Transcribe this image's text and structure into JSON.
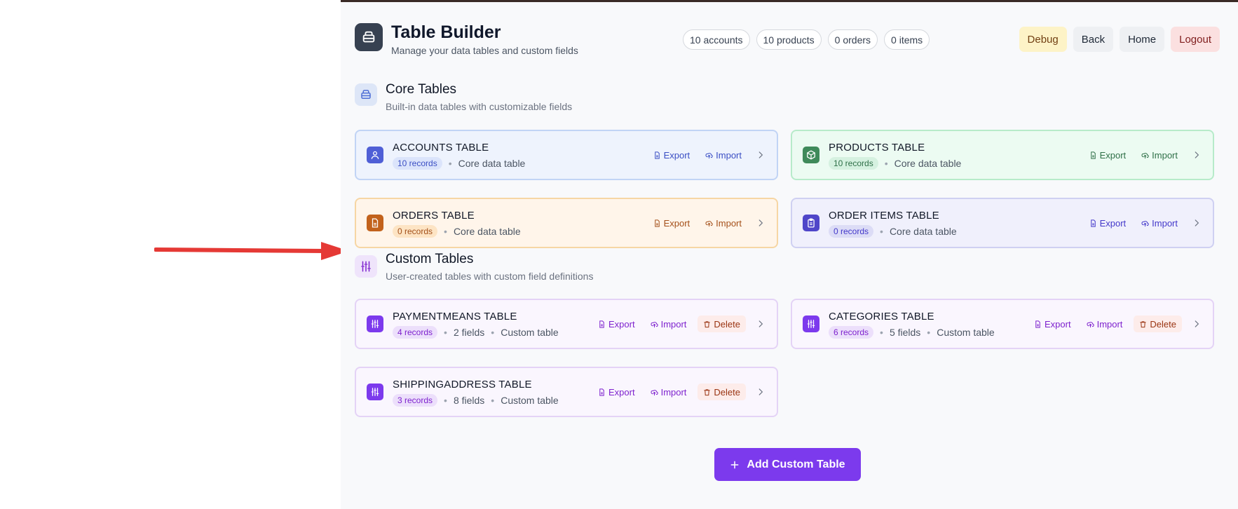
{
  "header": {
    "title": "Table Builder",
    "subtitle": "Manage your data tables and custom fields",
    "stats": [
      "10 accounts",
      "10 products",
      "0 orders",
      "0 items"
    ],
    "buttons": {
      "debug": "Debug",
      "back": "Back",
      "home": "Home",
      "logout": "Logout"
    }
  },
  "core": {
    "title": "Core Tables",
    "subtitle": "Built-in data tables with customizable fields",
    "tables": [
      {
        "name": "ACCOUNTS TABLE",
        "records": "10 records",
        "desc": "Core data table",
        "icon": "user-icon",
        "color": "#4f5fd6"
      },
      {
        "name": "PRODUCTS TABLE",
        "records": "10 records",
        "desc": "Core data table",
        "icon": "package-icon",
        "color": "#3f8a5a"
      },
      {
        "name": "ORDERS TABLE",
        "records": "0 records",
        "desc": "Core data table",
        "icon": "file-icon",
        "color": "#c2621c"
      },
      {
        "name": "ORDER ITEMS TABLE",
        "records": "0 records",
        "desc": "Core data table",
        "icon": "clipboard-icon",
        "color": "#4f46c9"
      }
    ]
  },
  "custom": {
    "title": "Custom Tables",
    "subtitle": "User-created tables with custom field definitions",
    "tables": [
      {
        "name": "PAYMENTMEANS TABLE",
        "records": "4 records",
        "fields": "2 fields",
        "desc": "Custom table",
        "icon": "sliders-icon"
      },
      {
        "name": "CATEGORIES TABLE",
        "records": "6 records",
        "fields": "5 fields",
        "desc": "Custom table",
        "icon": "sliders-icon"
      },
      {
        "name": "SHIPPINGADDRESS TABLE",
        "records": "3 records",
        "fields": "8 fields",
        "desc": "Custom table",
        "icon": "sliders-icon"
      }
    ]
  },
  "actions": {
    "export": "Export",
    "import": "Import",
    "delete": "Delete"
  },
  "add_button": {
    "icon": "plus-icon",
    "label": "Add Custom Table"
  },
  "colors": {
    "accent": "#7c3aed",
    "custom_badge_text": "#7e22ce",
    "arrow": "#e53935"
  }
}
